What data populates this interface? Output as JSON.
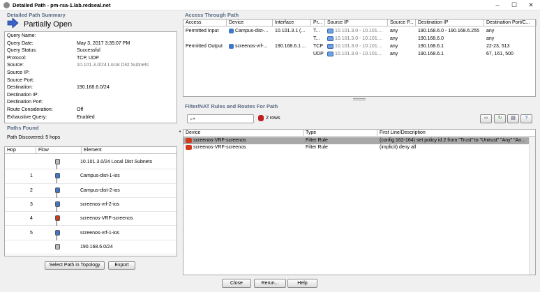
{
  "window": {
    "title": "Detailed Path - pm-rsa-1.lab.redseal.net",
    "min": "–",
    "max": "☐",
    "close": "✕"
  },
  "summary": {
    "section_title": "Detailed Path Summary",
    "status": "Partially Open",
    "fields": [
      {
        "label": "Query Name:",
        "value": ""
      },
      {
        "label": "Query Date:",
        "value": "May 3, 2017 3:35:07 PM"
      },
      {
        "label": "Query Status:",
        "value": "Successful"
      },
      {
        "label": "Protocol:",
        "value": "TCP, UDP"
      },
      {
        "label": "Source:",
        "value": "10.101.3.0/24 Local Dist Subnets"
      },
      {
        "label": "Source IP:",
        "value": ""
      },
      {
        "label": "Source Port:",
        "value": ""
      },
      {
        "label": "Destination:",
        "value": "190.168.6.0/24"
      },
      {
        "label": "Destination IP:",
        "value": ""
      },
      {
        "label": "Destination Port:",
        "value": ""
      },
      {
        "label": "Route Consideration:",
        "value": "Off"
      },
      {
        "label": "Exhaustive Query:",
        "value": "Enabled"
      }
    ]
  },
  "paths": {
    "section_title": "Paths Found",
    "discovered": "Path Discovered: 5 hops",
    "columns": [
      "Hop",
      "Flow",
      "Element"
    ],
    "rows": [
      {
        "hop": "",
        "element": "10.101.3.0/24 Local Dist Subnets",
        "kind": "subnet"
      },
      {
        "hop": "1",
        "element": "Campus-dist-1-ios",
        "kind": "router"
      },
      {
        "hop": "2",
        "element": "Campus-dist-2-ios",
        "kind": "router"
      },
      {
        "hop": "3",
        "element": "screenos-vrf-2-ios",
        "kind": "router"
      },
      {
        "hop": "4",
        "element": "screenos-VRF-screenos",
        "kind": "firewall"
      },
      {
        "hop": "5",
        "element": "screenos-vrf-1-ios",
        "kind": "router"
      },
      {
        "hop": "",
        "element": "190.168.6.0/24",
        "kind": "subnet"
      }
    ],
    "select_button": "Select Path in Topology",
    "export_button": "Export"
  },
  "access": {
    "section_title": "Access Through Path",
    "columns": [
      "Access",
      "Device",
      "Interface",
      "Pr...",
      "Source IP",
      "Source P...",
      "Destination IP",
      "Destination Port/C..."
    ],
    "rows": [
      {
        "access": "Permitted Input",
        "device": "Campus-dist-...",
        "iface": "10.101.3.1 (...",
        "proto": "T...",
        "src": "10.101.3.0 - 10.101....",
        "sport": "any",
        "dst": "190.168.6.0 - 190.168.6.255",
        "dport": "any"
      },
      {
        "access": "",
        "device": "",
        "iface": "",
        "proto": "T...",
        "src": "10.101.3.0 - 10.101....",
        "sport": "any",
        "dst": "190.168.6.0",
        "dport": "any"
      },
      {
        "access": "Permitted Output",
        "device": "screenos-vrf-...",
        "iface": "190.168.6.1 ...",
        "proto": "TCP",
        "src": "10.101.3.0 - 10.101....",
        "sport": "any",
        "dst": "190.168.6.1",
        "dport": "22-23, 513"
      },
      {
        "access": "",
        "device": "",
        "iface": "",
        "proto": "UDP",
        "src": "10.101.3.0 - 10.101....",
        "sport": "any",
        "dst": "190.168.6.1",
        "dport": "67, 161, 500"
      }
    ]
  },
  "filter": {
    "section_title": "Filter/NAT Rules and Routes For Path",
    "search_placeholder": "",
    "count": "2 rows",
    "columns": [
      "Device",
      "Type",
      "First Line/Description"
    ],
    "rows": [
      {
        "device": "screenos-VRF-screenos",
        "type": "Filter Rule",
        "desc": "(config:162-164) set policy id 2 from \"Trust\" to \"Untrust\" \"Any\" \"An..."
      },
      {
        "device": "screenos-VRF-screenos",
        "type": "Filter Rule",
        "desc": "(implicit) deny all"
      }
    ]
  },
  "footer": {
    "close": "Close",
    "rerun": "Rerun...",
    "help": "Help"
  }
}
